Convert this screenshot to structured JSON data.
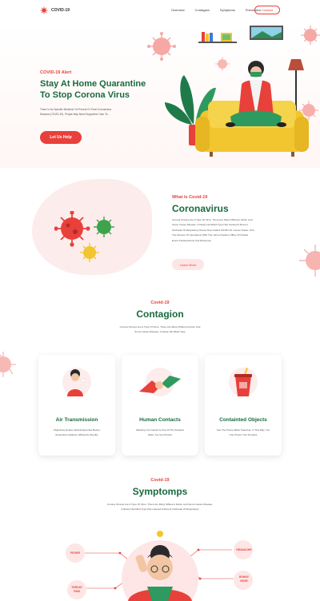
{
  "brand": {
    "name": "COVID-19"
  },
  "nav": {
    "items": [
      "Overview",
      "Contagion",
      "Symptoms",
      "Prevention"
    ],
    "contact_label": "Contact"
  },
  "hero": {
    "eyebrow": "COVID-19 Alert",
    "title_line1": "Stay At Home Quarantine",
    "title_line2": "To Stop Corona Virus",
    "desc_line1": "There Is No Specific Medicine To Prevent Or Treat Coronavirus",
    "desc_line2": "Disease (COVID-19). People May Need Supportive Care To...",
    "cta_label": "Let Us Help"
  },
  "about": {
    "eyebrow": "What Is Covid-19",
    "title": "Coronavirus",
    "lines": [
      "Corona Viruses Are A Type Of Virus. There Are Many Different Kinds, And",
      "Some Cause Disease. A Newly Identified Type Has Caused A Recent",
      "Outbreak Of Respiratory Illness Now Called COVID-19. Lauren Sauer, M.S.,",
      "The Director Of Operations With The Johns Hopkins Office Of Critical",
      "Event Preparedness And Response"
    ],
    "cta_label": "Learn More"
  },
  "contagion": {
    "eyebrow": "Covid-19",
    "title": "Contagion",
    "lines": [
      "Corona Viruses Are A Type Of Virus. There Are Many Different Kinds, And",
      "Some Cause Disease. A Newly Identified Type"
    ],
    "cards": [
      {
        "title": "Air Transmission",
        "lines": [
          "Objectively Evolve Tactical Expertise Before",
          "Extensible Initiatives. Efficiently Simplify"
        ]
      },
      {
        "title": "Human Contacts",
        "lines": [
          "Washing Your Hands Is One Of The Simplest",
          "Ways You Can Protect"
        ]
      },
      {
        "title": "Containted Objects",
        "lines": [
          "Use The Tissue While Sneezing. In This Way, You",
          "Can Protect Your Droplets"
        ]
      }
    ]
  },
  "symptoms": {
    "eyebrow": "Covid-19",
    "title": "Symptomps",
    "lines": [
      "Corona Viruses Are A Type Of Virus. There Are Many Different Kinds, And Some Cause Disease.",
      "A Newly Identified Type Has Caused A Recent Outbreak Of Respiratory"
    ],
    "tags": {
      "fever": "FEVER",
      "headache": "HEADACHE",
      "runny_nose_1": "RUNNY",
      "runny_nose_2": "NOSE",
      "throat_1": "THROAT",
      "throat_2": "PAIN"
    }
  },
  "colors": {
    "accent": "#e8403a",
    "dark_green": "#196a3e",
    "blush": "#fdecec",
    "sofa": "#f1c62f"
  }
}
